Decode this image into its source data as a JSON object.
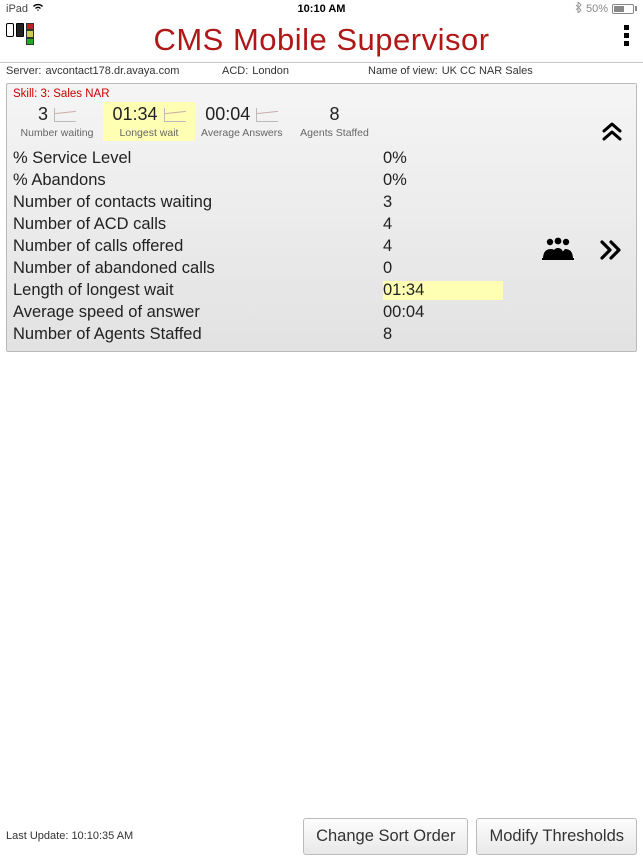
{
  "status": {
    "device": "iPad",
    "time": "10:10 AM",
    "battery": "50%"
  },
  "header": {
    "title": "CMS Mobile Supervisor"
  },
  "info": {
    "server_label": "Server:",
    "server": "avcontact178.dr.avaya.com",
    "acd_label": "ACD:",
    "acd": "London",
    "view_label": "Name of view:",
    "view": "UK CC NAR Sales"
  },
  "skill_label": "Skill: 3: Sales NAR",
  "kpis": [
    {
      "value": "3",
      "label": "Number waiting",
      "graph": true
    },
    {
      "value": "01:34",
      "label": "Longest wait",
      "graph": true,
      "highlight": true
    },
    {
      "value": "00:04",
      "label": "Average Answers",
      "graph": true
    },
    {
      "value": "8",
      "label": "Agents Staffed",
      "graph": false
    }
  ],
  "metrics": [
    {
      "label": "% Service Level",
      "value": "0%"
    },
    {
      "label": "% Abandons",
      "value": "0%"
    },
    {
      "label": "Number of contacts waiting",
      "value": "3"
    },
    {
      "label": "Number of ACD calls",
      "value": "4"
    },
    {
      "label": "Number of calls offered",
      "value": "4"
    },
    {
      "label": "Number of abandoned calls",
      "value": "0"
    },
    {
      "label": "Length of longest wait",
      "value": "01:34",
      "highlight": true
    },
    {
      "label": "Average speed of answer",
      "value": "00:04"
    },
    {
      "label": "Number of Agents Staffed",
      "value": "8"
    }
  ],
  "footer": {
    "last_update_label": "Last Update:",
    "last_update": "10:10:35 AM",
    "sort_button": "Change Sort Order",
    "thresholds_button": "Modify Thresholds"
  }
}
